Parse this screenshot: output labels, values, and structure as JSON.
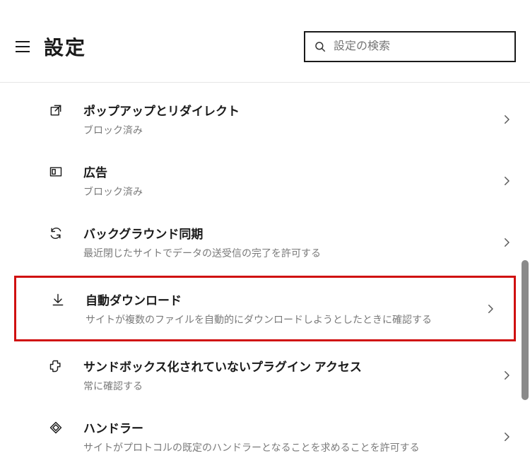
{
  "header": {
    "title": "設定",
    "search_placeholder": "設定の検索"
  },
  "settings": [
    {
      "icon": "external-link",
      "title": "ポップアップとリダイレクト",
      "desc": "ブロック済み"
    },
    {
      "icon": "ad",
      "title": "広告",
      "desc": "ブロック済み"
    },
    {
      "icon": "sync",
      "title": "バックグラウンド同期",
      "desc": "最近閉じたサイトでデータの送受信の完了を許可する"
    },
    {
      "icon": "download",
      "title": "自動ダウンロード",
      "desc": "サイトが複数のファイルを自動的にダウンロードしようとしたときに確認する",
      "highlight": true
    },
    {
      "icon": "plugin",
      "title": "サンドボックス化されていないプラグイン アクセス",
      "desc": "常に確認する"
    },
    {
      "icon": "handler",
      "title": "ハンドラー",
      "desc": "サイトがプロトコルの既定のハンドラーとなることを求めることを許可する"
    }
  ]
}
